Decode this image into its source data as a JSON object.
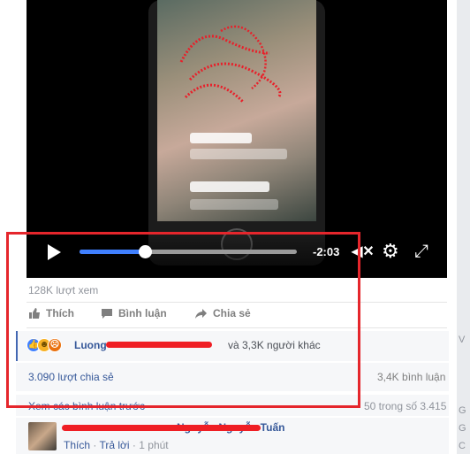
{
  "video": {
    "time_remaining": "-2:03",
    "progress": 0.3,
    "icons": {
      "play": "play-icon",
      "volume": "volume-muted-icon",
      "settings": "gear-icon",
      "fullscreen": "expand-icon"
    }
  },
  "views": "128K lượt xem",
  "actions": {
    "like": "Thích",
    "comment": "Bình luận",
    "share": "Chia sẻ"
  },
  "reactions": {
    "partial_name": "Luong",
    "others": "và 3,3K người khác"
  },
  "stats": {
    "shares": "3.090 lượt chia sẻ",
    "comments": "3,4K bình luận"
  },
  "comments": {
    "view_previous": "Xem các bình luận trước",
    "paging": "50 trong số 3.415",
    "first": {
      "author_visible": "Nguyễn Nguyễn Tuấn",
      "like": "Thích",
      "reply": "Trả lời",
      "time": "1 phút"
    }
  },
  "colors": {
    "accent": "#4080ff",
    "link": "#365899",
    "highlight": "#e5262c"
  }
}
